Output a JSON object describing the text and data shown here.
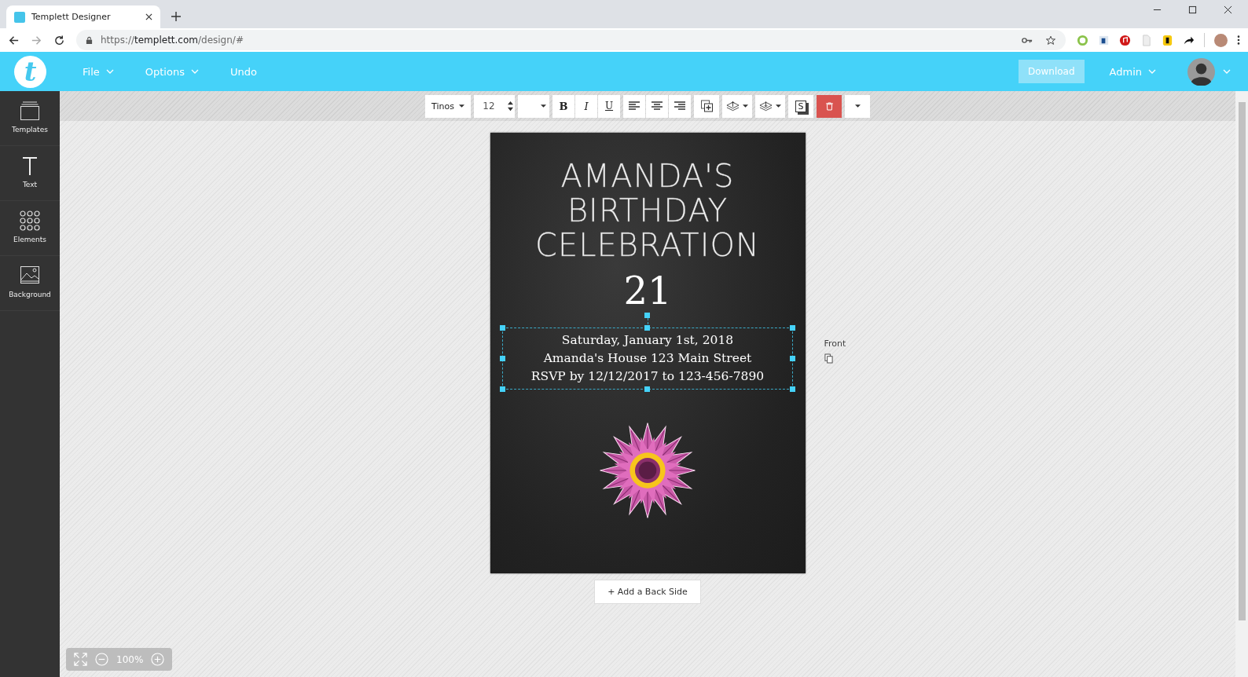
{
  "browser": {
    "tab_title": "Templett Designer",
    "url_scheme": "https://",
    "url_host": "templett.com",
    "url_path": "/design/#"
  },
  "header": {
    "logo": "t",
    "menus": [
      {
        "label": "File",
        "dropdown": true
      },
      {
        "label": "Options",
        "dropdown": true
      },
      {
        "label": "Undo",
        "dropdown": false
      }
    ],
    "download": "Download",
    "admin": "Admin"
  },
  "sidebar": {
    "items": [
      {
        "label": "Templates",
        "kind": "templates"
      },
      {
        "label": "Text",
        "kind": "text"
      },
      {
        "label": "Elements",
        "kind": "elements"
      },
      {
        "label": "Background",
        "kind": "background"
      }
    ]
  },
  "toolbar": {
    "font": "Tinos",
    "size": "12",
    "styles": [
      {
        "label": "B",
        "kind": "bold"
      },
      {
        "label": "I",
        "kind": "italic"
      },
      {
        "label": "U",
        "kind": "underline"
      }
    ],
    "aligns": [
      {
        "kind": "left"
      },
      {
        "kind": "center"
      },
      {
        "kind": "right"
      }
    ],
    "shadow_label": "S"
  },
  "card": {
    "title_lines": [
      "AMANDA'S",
      "BIRTHDAY",
      "CELEBRATION"
    ],
    "number": "21",
    "detail_lines": [
      "Saturday, January 1st, 2018",
      "Amanda's House 123 Main Street",
      "RSVP by 12/12/2017 to 123-456-7890"
    ],
    "details_selected": true
  },
  "side_label": "Front",
  "add_back": "+ Add a Back Side",
  "zoom": "100%"
}
